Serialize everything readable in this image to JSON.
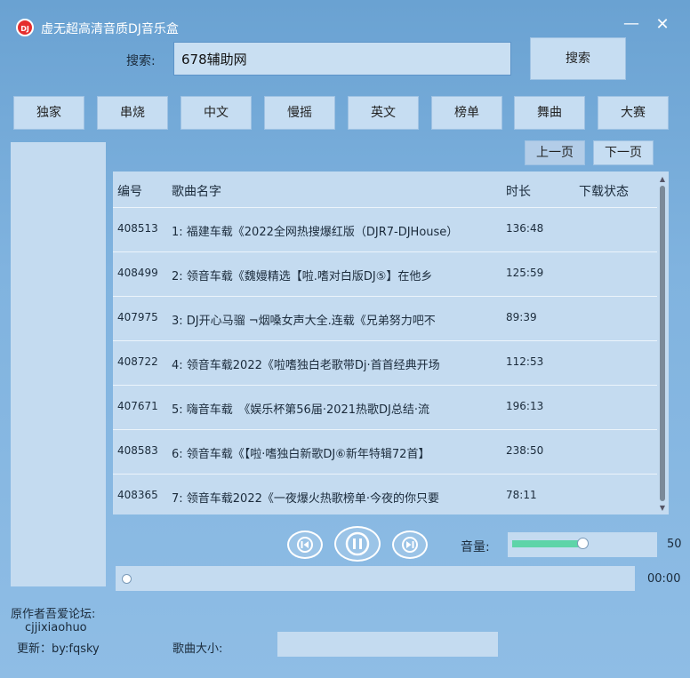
{
  "app": {
    "logo_text": "DJ",
    "title": "虚无超高清音质DJ音乐盒",
    "minimize": "—",
    "close": "✕"
  },
  "search": {
    "label": "搜索:",
    "value": "678辅助网",
    "button": "搜索"
  },
  "categories": [
    "独家",
    "串烧",
    "中文",
    "慢摇",
    "英文",
    "榜单",
    "舞曲",
    "大赛"
  ],
  "pager": {
    "prev": "上一页",
    "next": "下一页"
  },
  "table": {
    "headers": {
      "id": "编号",
      "name": "歌曲名字",
      "duration": "时长",
      "status": "下载状态"
    },
    "rows": [
      {
        "id": "408513",
        "name": "1: 福建车载《2022全网热搜爆红版（DJR7-DJHouse）",
        "duration": "136:48"
      },
      {
        "id": "408499",
        "name": "2: 领音车载《魏嫚精选【啦.嗜对白版DJ⑤】在他乡",
        "duration": "125:59"
      },
      {
        "id": "407975",
        "name": "3: DJ开心马骝 ¬烟嗓女声大全.连载《兄弟努力吧不",
        "duration": "89:39"
      },
      {
        "id": "408722",
        "name": "4: 领音车载2022《啦嗜独白老歌带Dj·首首经典开场",
        "duration": "112:53"
      },
      {
        "id": "407671",
        "name": "5: 嗨音车载　《娱乐杯第56届·2021热歌DJ总结·流",
        "duration": "196:13"
      },
      {
        "id": "408583",
        "name": "6: 领音车载《【啦·嗜独白新歌DJ⑥新年特辑72首】",
        "duration": "238:50"
      },
      {
        "id": "408365",
        "name": "7: 领音车载2022《一夜爆火热歌榜单·今夜的你只要",
        "duration": "78:11"
      }
    ]
  },
  "player": {
    "volume_label": "音量:",
    "volume_value": "50",
    "volume_fraction": 0.5,
    "time": "00:00",
    "progress_fraction": 0.0
  },
  "credits": {
    "line1": "原作者吾爱论坛:",
    "line2": "cjjixiaohuo",
    "line3": "更新：by:fqsky"
  },
  "song_size_label": "歌曲大小:",
  "colors": {
    "accent": "#5ed4a8",
    "panel": "#c4dbf0",
    "background": "#80b3df"
  },
  "icons": [
    "prev-track-icon",
    "pause-icon",
    "next-track-icon"
  ]
}
